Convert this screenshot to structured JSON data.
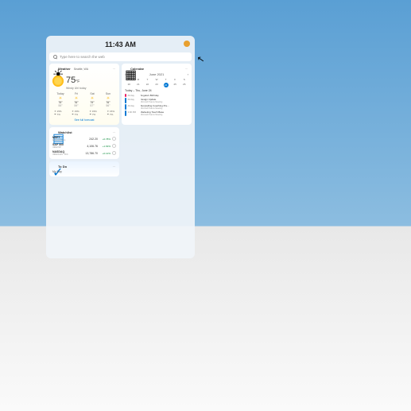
{
  "clock": "11:43 AM",
  "search": {
    "placeholder": "Type here to search the web"
  },
  "weather": {
    "title": "Weather",
    "location": "Seattle, WA",
    "temp": "75",
    "unit": "°F",
    "condition": "Windy Uhl today",
    "forecast": [
      {
        "day": "Today",
        "hi": "75°",
        "lo": "55°"
      },
      {
        "day": "Fri",
        "hi": "76°",
        "lo": "59°"
      },
      {
        "day": "Sat",
        "hi": "79°",
        "lo": "57°"
      },
      {
        "day": "Sun",
        "hi": "76°",
        "lo": "56°"
      }
    ],
    "stats": [
      {
        "label": "☀ 15%",
        "val": "☂ 7%"
      },
      {
        "label": "☀ 15%",
        "val": "☂ 7%"
      },
      {
        "label": "☀ 15%",
        "val": "☂ 7%"
      },
      {
        "label": "☀ 15%",
        "val": "☂ 7%"
      }
    ],
    "link": "See full forecast"
  },
  "calendar": {
    "title": "Calendar",
    "month": "June 2021",
    "nav_prev": "‹",
    "nav_next": "›",
    "dow": [
      "S",
      "M",
      "T",
      "W",
      "T",
      "F",
      "S"
    ],
    "days": [
      "20",
      "21",
      "22",
      "23",
      "24",
      "25",
      "26"
    ],
    "today_idx": 4,
    "date_label": "Today – Thu, June 24",
    "events": [
      {
        "time": "All day",
        "title": "Angela's Birthday",
        "loc": "",
        "color": "#e91e63"
      },
      {
        "time": "All day",
        "title": "Design Update",
        "loc": "Microsoft Teams Meeting",
        "color": "#0078d4"
      },
      {
        "time": "All day",
        "title": "Storytelling Coaching Pre…",
        "loc": "Microsoft Teams Meeting",
        "color": "#0078d4"
      },
      {
        "time": "3:00 PM",
        "title": "Marketing Touch Base",
        "loc": "Microsoft Teams Meeting",
        "color": "#0078d4"
      }
    ]
  },
  "stocks": {
    "title": "Watchlist",
    "items": [
      {
        "sym": "MSFT",
        "sub": "Microsoft Corp",
        "price": "242.20",
        "chg": "+0.78%",
        "pos": true
      },
      {
        "sym": "S&P 500",
        "sub": "INDEXSP",
        "price": "4,106.76",
        "chg": "+1.63%",
        "pos": true
      },
      {
        "sym": "NASDAQ",
        "sub": "INDEXNAS: .IXIC",
        "price": "13,786.70",
        "chg": "+0.12%",
        "pos": true
      }
    ]
  },
  "todo": {
    "title": "To Do",
    "sub": "My Day"
  }
}
